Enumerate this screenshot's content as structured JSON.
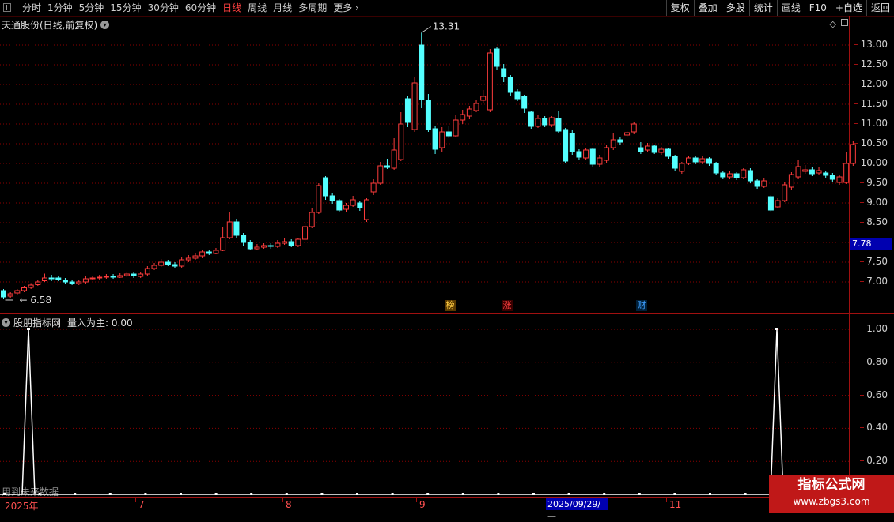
{
  "toolbar": {
    "timeframes": [
      "分时",
      "1分钟",
      "5分钟",
      "15分钟",
      "30分钟",
      "60分钟",
      "日线",
      "周线",
      "月线",
      "多周期",
      "更多"
    ],
    "active_timeframe": "日线",
    "actions": [
      "复权",
      "叠加",
      "多股",
      "统计",
      "画线",
      "F10",
      "+自选",
      "返回"
    ]
  },
  "main_pane": {
    "title": "天通股份(日线,前复权)",
    "high_label": "13.31",
    "low_label": "6.58",
    "cursor_price": "7.78",
    "price_ticks": [
      "13.00",
      "12.50",
      "12.00",
      "11.50",
      "11.00",
      "10.50",
      "10.00",
      "9.50",
      "9.00",
      "8.50",
      "8.00",
      "7.50",
      "7.00"
    ],
    "badges": [
      {
        "text": "榜",
        "color": "#ffcc44"
      },
      {
        "text": "涨",
        "color": "#ff4040"
      },
      {
        "text": "财",
        "color": "#40a0ff"
      }
    ]
  },
  "indicator_pane": {
    "title": "股朋指标网",
    "label": "量入为主: 0.00",
    "ticks": [
      "1.00",
      "0.80",
      "0.60",
      "0.40",
      "0.20"
    ],
    "future_note": "用到未来数据"
  },
  "time_axis": {
    "labels": [
      "2025年",
      "7",
      "8",
      "9",
      "11"
    ],
    "cursor_date": "2025/09/29/—"
  },
  "watermark": {
    "line1": "指标公式网",
    "line2": "www.zbgs3.com"
  },
  "colors": {
    "up": "#ff3c3c",
    "down": "#54ffff",
    "grid": "#8b0000",
    "axis": "#a01010"
  },
  "chart_data": {
    "type": "candlestick",
    "title": "天通股份(日线,前复权)",
    "ylim": [
      6.4,
      13.4
    ],
    "y_ticks": [
      7.0,
      7.5,
      8.0,
      8.5,
      9.0,
      9.5,
      10.0,
      10.5,
      11.0,
      11.5,
      12.0,
      12.5,
      13.0
    ],
    "candles": [
      [
        6.78,
        6.62,
        6.82,
        6.58
      ],
      [
        6.64,
        6.7,
        6.74,
        6.6
      ],
      [
        6.72,
        6.78,
        6.82,
        6.68
      ],
      [
        6.78,
        6.85,
        6.9,
        6.74
      ],
      [
        6.86,
        6.92,
        6.97,
        6.82
      ],
      [
        6.93,
        7.0,
        7.06,
        6.9
      ],
      [
        7.03,
        7.1,
        7.21,
        7.0
      ],
      [
        7.1,
        7.08,
        7.18,
        7.02
      ],
      [
        7.1,
        7.06,
        7.14,
        7.02
      ],
      [
        7.05,
        7.0,
        7.1,
        6.96
      ],
      [
        7.0,
        6.96,
        7.06,
        6.92
      ],
      [
        6.96,
        7.0,
        7.06,
        6.92
      ],
      [
        7.0,
        7.08,
        7.14,
        6.96
      ],
      [
        7.08,
        7.1,
        7.16,
        7.04
      ],
      [
        7.1,
        7.12,
        7.18,
        7.06
      ],
      [
        7.12,
        7.14,
        7.2,
        7.08
      ],
      [
        7.14,
        7.12,
        7.2,
        7.08
      ],
      [
        7.12,
        7.16,
        7.22,
        7.1
      ],
      [
        7.16,
        7.2,
        7.26,
        7.12
      ],
      [
        7.2,
        7.16,
        7.24,
        7.1
      ],
      [
        7.14,
        7.2,
        7.26,
        7.1
      ],
      [
        7.2,
        7.34,
        7.4,
        7.16
      ],
      [
        7.34,
        7.42,
        7.48,
        7.3
      ],
      [
        7.42,
        7.5,
        7.58,
        7.38
      ],
      [
        7.5,
        7.44,
        7.56,
        7.4
      ],
      [
        7.44,
        7.4,
        7.5,
        7.36
      ],
      [
        7.4,
        7.56,
        7.64,
        7.36
      ],
      [
        7.56,
        7.6,
        7.68,
        7.5
      ],
      [
        7.6,
        7.66,
        7.74,
        7.56
      ],
      [
        7.66,
        7.76,
        7.82,
        7.6
      ],
      [
        7.76,
        7.72,
        7.8,
        7.68
      ],
      [
        7.72,
        7.8,
        7.86,
        7.7
      ],
      [
        7.8,
        8.12,
        8.4,
        7.78
      ],
      [
        8.12,
        8.52,
        8.78,
        8.08
      ],
      [
        8.52,
        8.18,
        8.6,
        8.1
      ],
      [
        8.18,
        8.0,
        8.24,
        7.92
      ],
      [
        8.0,
        7.84,
        8.06,
        7.8
      ],
      [
        7.84,
        7.88,
        7.96,
        7.8
      ],
      [
        7.88,
        7.92,
        7.98,
        7.84
      ],
      [
        7.92,
        7.9,
        7.98,
        7.84
      ],
      [
        7.9,
        7.98,
        8.06,
        7.86
      ],
      [
        7.98,
        8.02,
        8.1,
        7.94
      ],
      [
        8.02,
        7.92,
        8.08,
        7.88
      ],
      [
        7.92,
        8.08,
        8.12,
        7.88
      ],
      [
        8.08,
        8.4,
        8.5,
        8.04
      ],
      [
        8.4,
        8.76,
        8.86,
        8.36
      ],
      [
        8.76,
        9.44,
        9.5,
        8.72
      ],
      [
        9.64,
        9.18,
        9.68,
        9.08
      ],
      [
        9.18,
        9.06,
        9.24,
        8.98
      ],
      [
        9.06,
        8.82,
        9.1,
        8.78
      ],
      [
        8.84,
        8.94,
        9.0,
        8.78
      ],
      [
        8.94,
        9.08,
        9.18,
        8.9
      ],
      [
        9.0,
        8.88,
        9.06,
        8.8
      ],
      [
        8.58,
        9.08,
        9.12,
        8.52
      ],
      [
        9.28,
        9.5,
        9.6,
        9.2
      ],
      [
        9.5,
        9.94,
        10.04,
        9.46
      ],
      [
        9.94,
        9.9,
        10.12,
        9.86
      ],
      [
        9.88,
        10.34,
        10.64,
        9.84
      ],
      [
        10.1,
        11.0,
        11.3,
        10.06
      ],
      [
        11.64,
        11.04,
        11.7,
        10.92
      ],
      [
        10.86,
        12.04,
        12.2,
        10.8
      ],
      [
        13.0,
        11.62,
        13.31,
        11.4
      ],
      [
        11.6,
        10.86,
        11.76,
        10.8
      ],
      [
        10.88,
        10.36,
        10.96,
        10.24
      ],
      [
        10.4,
        10.8,
        10.92,
        10.3
      ],
      [
        10.8,
        10.7,
        10.94,
        10.64
      ],
      [
        10.7,
        11.1,
        11.22,
        10.66
      ],
      [
        11.1,
        11.24,
        11.36,
        11.0
      ],
      [
        11.2,
        11.38,
        11.46,
        11.12
      ],
      [
        11.34,
        11.52,
        11.62,
        11.3
      ],
      [
        11.6,
        11.7,
        11.86,
        11.54
      ],
      [
        11.36,
        12.8,
        12.9,
        11.3
      ],
      [
        12.9,
        12.46,
        12.94,
        12.36
      ],
      [
        12.4,
        12.2,
        12.52,
        12.06
      ],
      [
        12.18,
        11.8,
        12.24,
        11.7
      ],
      [
        11.82,
        11.64,
        11.88,
        11.58
      ],
      [
        11.7,
        11.4,
        11.74,
        11.28
      ],
      [
        11.3,
        10.94,
        11.34,
        10.88
      ],
      [
        10.94,
        11.14,
        11.24,
        10.9
      ],
      [
        11.14,
        10.98,
        11.2,
        10.92
      ],
      [
        10.98,
        11.16,
        11.2,
        10.92
      ],
      [
        11.14,
        10.82,
        11.34,
        10.78
      ],
      [
        10.86,
        10.06,
        10.9,
        10.0
      ],
      [
        10.76,
        10.3,
        10.84,
        10.22
      ],
      [
        10.3,
        10.16,
        10.36,
        10.08
      ],
      [
        10.14,
        10.34,
        10.4,
        10.1
      ],
      [
        10.36,
        9.98,
        10.4,
        9.92
      ],
      [
        9.98,
        10.14,
        10.22,
        9.92
      ],
      [
        10.08,
        10.4,
        10.48,
        10.02
      ],
      [
        10.4,
        10.6,
        10.76,
        10.34
      ],
      [
        10.6,
        10.54,
        10.66,
        10.48
      ],
      [
        10.72,
        10.78,
        10.82,
        10.66
      ],
      [
        10.8,
        11.0,
        11.06,
        10.74
      ],
      [
        10.4,
        10.3,
        10.54,
        10.24
      ],
      [
        10.34,
        10.44,
        10.52,
        10.28
      ],
      [
        10.44,
        10.28,
        10.48,
        10.24
      ],
      [
        10.28,
        10.36,
        10.42,
        10.22
      ],
      [
        10.36,
        10.18,
        10.4,
        10.12
      ],
      [
        10.18,
        9.88,
        10.22,
        9.82
      ],
      [
        9.8,
        10.0,
        10.04,
        9.74
      ],
      [
        10.0,
        10.14,
        10.2,
        9.96
      ],
      [
        10.14,
        10.04,
        10.18,
        9.98
      ],
      [
        10.04,
        10.12,
        10.18,
        9.98
      ],
      [
        10.12,
        10.0,
        10.16,
        9.94
      ],
      [
        10.0,
        9.76,
        10.04,
        9.7
      ],
      [
        9.76,
        9.66,
        9.82,
        9.6
      ],
      [
        9.66,
        9.74,
        9.82,
        9.6
      ],
      [
        9.74,
        9.64,
        9.78,
        9.58
      ],
      [
        9.64,
        9.84,
        9.88,
        9.6
      ],
      [
        9.82,
        9.56,
        9.88,
        9.5
      ],
      [
        9.56,
        9.42,
        9.6,
        9.36
      ],
      [
        9.42,
        9.56,
        9.62,
        9.38
      ],
      [
        9.16,
        8.82,
        9.2,
        8.78
      ],
      [
        8.9,
        9.06,
        9.12,
        8.86
      ],
      [
        9.06,
        9.46,
        9.54,
        9.02
      ],
      [
        9.4,
        9.72,
        9.78,
        9.34
      ],
      [
        9.66,
        9.92,
        10.08,
        9.6
      ],
      [
        9.8,
        9.84,
        9.96,
        9.74
      ],
      [
        9.84,
        9.74,
        9.92,
        9.68
      ],
      [
        9.76,
        9.82,
        9.9,
        9.7
      ],
      [
        9.76,
        9.7,
        9.82,
        9.64
      ],
      [
        9.7,
        9.6,
        9.76,
        9.52
      ],
      [
        9.52,
        9.66,
        9.72,
        9.46
      ],
      [
        9.52,
        10.0,
        10.3,
        9.48
      ],
      [
        10.0,
        10.48,
        10.56,
        9.94
      ]
    ],
    "indicator": {
      "name": "量入为主",
      "ylim": [
        0,
        1.05
      ],
      "spike_candle_index": [
        0,
        117
      ],
      "spike_value": 1.0,
      "baseline": 0.0
    }
  }
}
